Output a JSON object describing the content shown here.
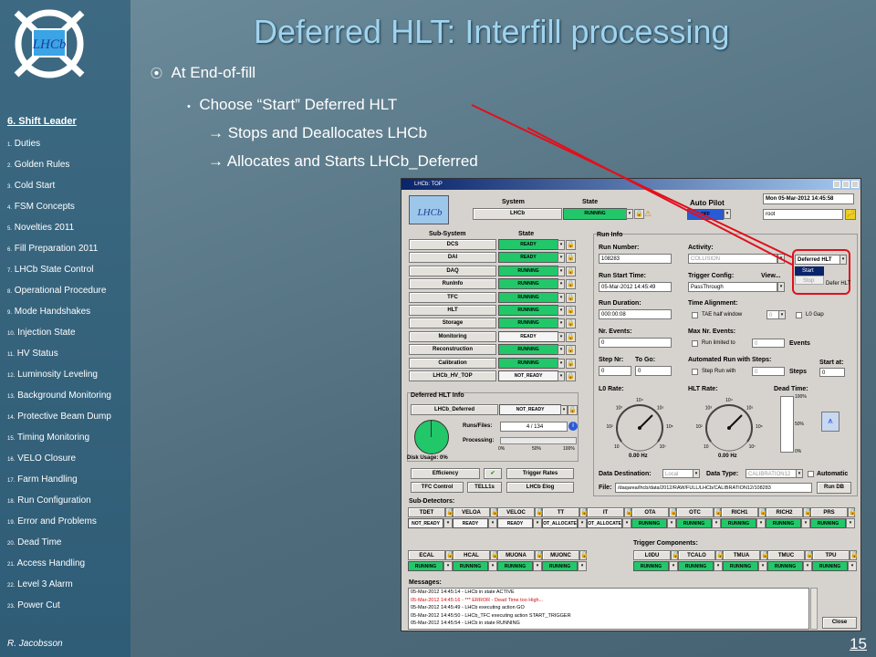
{
  "sidebar": {
    "logo_text": "LHCb",
    "section_title": "6. Shift Leader",
    "items": [
      {
        "n": "1.",
        "t": "Duties"
      },
      {
        "n": "2.",
        "t": "Golden Rules"
      },
      {
        "n": "3.",
        "t": "Cold Start"
      },
      {
        "n": "4.",
        "t": "FSM Concepts"
      },
      {
        "n": "5.",
        "t": "Novelties 2011"
      },
      {
        "n": "6.",
        "t": "Fill Preparation 2011"
      },
      {
        "n": "7.",
        "t": "LHCb State Control"
      },
      {
        "n": "8.",
        "t": "Operational Procedure"
      },
      {
        "n": "9.",
        "t": "Mode Handshakes"
      },
      {
        "n": "10.",
        "t": "Injection State"
      },
      {
        "n": "11.",
        "t": "HV Status"
      },
      {
        "n": "12.",
        "t": "Luminosity Leveling"
      },
      {
        "n": "13.",
        "t": "Background Monitoring"
      },
      {
        "n": "14.",
        "t": "Protective Beam Dump"
      },
      {
        "n": "15.",
        "t": "Timing Monitoring"
      },
      {
        "n": "16.",
        "t": "VELO Closure"
      },
      {
        "n": "17.",
        "t": "Farm Handling"
      },
      {
        "n": "18.",
        "t": "Run Configuration"
      },
      {
        "n": "19.",
        "t": "Error and Problems"
      },
      {
        "n": "20.",
        "t": "Dead Time"
      },
      {
        "n": "21.",
        "t": "Access Handling"
      },
      {
        "n": "22.",
        "t": "Level 3 Alarm"
      },
      {
        "n": "23.",
        "t": "Power Cut"
      }
    ],
    "author": "R. Jacobsson"
  },
  "slide": {
    "title": "Deferred HLT: Interfill processing",
    "bullet1": "At End-of-fill",
    "bullet2": "Choose “Start” Deferred HLT",
    "bullet3": " Stops and Deallocates LHCb",
    "bullet4": " Allocates and Starts LHCb_Deferred",
    "page": "15",
    "accent": "#9fd4ef",
    "arrow_color": "#e0101c"
  },
  "win": {
    "title": "LHCb: TOP",
    "system_label": "System",
    "state_label": "State",
    "system": "LHCb",
    "state": "RUNNING",
    "autopilot_label": "Auto Pilot",
    "autopilot": "OFF",
    "datetime": "Mon 05-Mar-2012   14:45:58",
    "user": "root",
    "subsystem_label": "Sub-System",
    "subsystem_state_label": "State",
    "subsystems": [
      {
        "name": "DCS",
        "state": "READY",
        "color": "#22c76a"
      },
      {
        "name": "DAI",
        "state": "READY",
        "color": "#22c76a"
      },
      {
        "name": "DAQ",
        "state": "RUNNING",
        "color": "#22c76a"
      },
      {
        "name": "RunInfo",
        "state": "RUNNING",
        "color": "#22c76a"
      },
      {
        "name": "TFC",
        "state": "RUNNING",
        "color": "#22c76a"
      },
      {
        "name": "HLT",
        "state": "RUNNING",
        "color": "#22c76a"
      },
      {
        "name": "Storage",
        "state": "RUNNING",
        "color": "#22c76a"
      },
      {
        "name": "Monitoring",
        "state": "READY",
        "color": "#f4f4f4"
      },
      {
        "name": "Reconstruction",
        "state": "RUNNING",
        "color": "#22c76a"
      },
      {
        "name": "Calibration",
        "state": "RUNNING",
        "color": "#22c76a"
      },
      {
        "name": "LHCb_HV_TOP",
        "state": "NOT_READY",
        "color": "#f4f4f4"
      }
    ],
    "deferred": {
      "label": "Deferred HLT Info",
      "name": "LHCb_Deferred",
      "state": "NOT_READY",
      "runs_label": "Runs/Files:",
      "runs": "4 / 134",
      "processing_label": "Processing:",
      "ticks": [
        "0%",
        "50%",
        "100%"
      ],
      "disk_label": "Disk Usage:",
      "disk": "0%"
    },
    "buttons": {
      "efficiency": "Efficiency",
      "trigger_rates": "Trigger Rates",
      "tfc_control": "TFC Control",
      "tell1s": "TELL1s",
      "elog": "LHCb Elog",
      "rundb": "Run DB",
      "close": "Close",
      "view": "View..."
    },
    "runinfo": {
      "label": "Run Info",
      "run_number_label": "Run Number:",
      "run_number": "108283",
      "activity_label": "Activity:",
      "activity": "COLLISION",
      "start_time_label": "Run Start Time:",
      "start_time": "05-Mar-2012 14:45:49",
      "trigger_config_label": "Trigger Config:",
      "trigger_config": "PassThrough",
      "duration_label": "Run Duration:",
      "duration": "000:00:08",
      "time_alignment_label": "Time Alignment:",
      "tae_label": "TAE half window",
      "tae": "0",
      "l0gap_label": "L0 Gap",
      "nevents_label": "Nr. Events:",
      "nevents": "0",
      "maxnr_label": "Max Nr. Events:",
      "runlimited_label": "Run limited to",
      "runlimited": "0",
      "events_label": "Events",
      "stepnr_label": "Step Nr:",
      "stepnr": "0",
      "todo_label": "To Go:",
      "todo": "0",
      "automated_label": "Automated Run with Steps:",
      "steprun_label": "Step Run with",
      "steprun": "0",
      "steps_label": "Steps",
      "startat_label": "Start at:",
      "startat": "0",
      "l0rate_label": "L0 Rate:",
      "l0rate": "0.00 Hz",
      "hltrate_label": "HLT Rate:",
      "hltrate": "0.00 Hz",
      "deadtime_label": "Dead Time:",
      "dead_ticks": [
        "100%",
        "50%",
        "0%"
      ],
      "gauge_ticks": [
        "10",
        "10²",
        "10³",
        "10⁴",
        "10⁵",
        "10⁶",
        "10⁷"
      ],
      "datadest_label": "Data Destination:",
      "datadest": "Local",
      "datatype_label": "Data Type:",
      "datatype": "CALIBRATION12",
      "automatic_label": "Automatic",
      "file_label": "File:",
      "file": "/daqarea/lhcb/data/2012/RAW/FULL/LHCb/CALIBRATION12/108283"
    },
    "deferred_menu": {
      "value": "Deferred HLT",
      "start": "Start",
      "stop": "Stop",
      "defer_label": "Defer HLT"
    },
    "subdetectors_label": "Sub-Detectors:",
    "subdetectors": [
      {
        "name": "TDET",
        "state": "NOT_READY",
        "color": "#f4f4f4"
      },
      {
        "name": "VELOA",
        "state": "READY",
        "color": "#f4f4f4"
      },
      {
        "name": "VELOC",
        "state": "READY",
        "color": "#f4f4f4"
      },
      {
        "name": "TT",
        "state": "OT_ALLOCATE",
        "color": "#f4f4f4"
      },
      {
        "name": "IT",
        "state": "OT_ALLOCATE",
        "color": "#f4f4f4"
      },
      {
        "name": "OTA",
        "state": "RUNNING",
        "color": "#22c76a"
      },
      {
        "name": "OTC",
        "state": "RUNNING",
        "color": "#22c76a"
      },
      {
        "name": "RICH1",
        "state": "RUNNING",
        "color": "#22c76a"
      },
      {
        "name": "RICH2",
        "state": "RUNNING",
        "color": "#22c76a"
      },
      {
        "name": "PRS",
        "state": "RUNNING",
        "color": "#22c76a"
      }
    ],
    "subdetectors2": [
      {
        "name": "ECAL",
        "state": "RUNNING",
        "color": "#22c76a"
      },
      {
        "name": "HCAL",
        "state": "RUNNING",
        "color": "#22c76a"
      },
      {
        "name": "MUONA",
        "state": "RUNNING",
        "color": "#22c76a"
      },
      {
        "name": "MUONC",
        "state": "RUNNING",
        "color": "#22c76a"
      }
    ],
    "trigger_label": "Trigger Components:",
    "triggers": [
      {
        "name": "L0DU",
        "state": "RUNNING",
        "color": "#22c76a"
      },
      {
        "name": "TCALO",
        "state": "RUNNING",
        "color": "#22c76a"
      },
      {
        "name": "TMUA",
        "state": "RUNNING",
        "color": "#22c76a"
      },
      {
        "name": "TMUC",
        "state": "RUNNING",
        "color": "#22c76a"
      },
      {
        "name": "TPU",
        "state": "RUNNING",
        "color": "#22c76a"
      }
    ],
    "messages_label": "Messages:",
    "messages": [
      {
        "t": "05-Mar-2012 14:45:14 - LHCb in state ACTIVE",
        "c": "#000"
      },
      {
        "t": "05-Mar-2012 14:45:16 - *** ERROR - Dead Time too High...",
        "c": "#d01010"
      },
      {
        "t": "05-Mar-2012 14:45:49 - LHCb executing action GO",
        "c": "#000"
      },
      {
        "t": "05-Mar-2012 14:45:50 - LHCb_TFC executing action START_TRIGGER",
        "c": "#000"
      },
      {
        "t": "05-Mar-2012 14:45:54 - LHCb in state RUNNING",
        "c": "#000"
      }
    ]
  }
}
